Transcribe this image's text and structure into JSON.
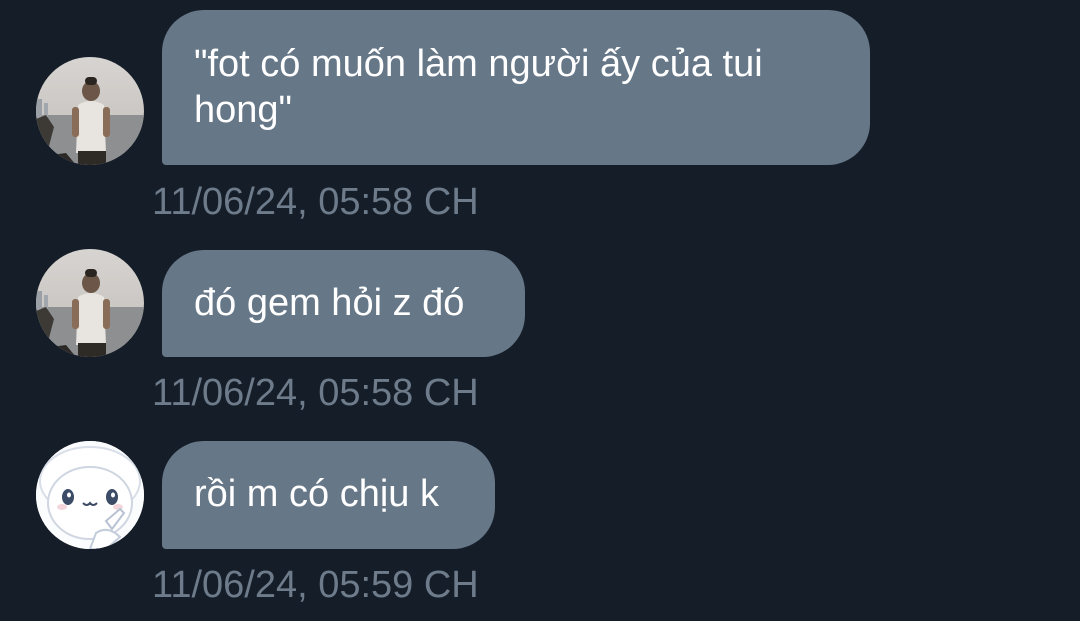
{
  "conversation": {
    "messages": [
      {
        "sender": "photo-contact",
        "avatar": "photo-avatar",
        "text": "\"fot có muốn làm người ấy của tui hong\"",
        "time": "11/06/24, 05:58 CH"
      },
      {
        "sender": "photo-contact",
        "avatar": "photo-avatar",
        "text": "đó gem hỏi z đó",
        "time": "11/06/24, 05:58 CH"
      },
      {
        "sender": "cartoon-contact",
        "avatar": "cartoon-avatar",
        "text": "rồi m có chịu k",
        "time": "11/06/24, 05:59 CH"
      }
    ]
  },
  "colors": {
    "background": "#151d28",
    "bubble": "#667788",
    "bubble_text": "#ffffff",
    "timestamp": "#6d7b8b"
  }
}
